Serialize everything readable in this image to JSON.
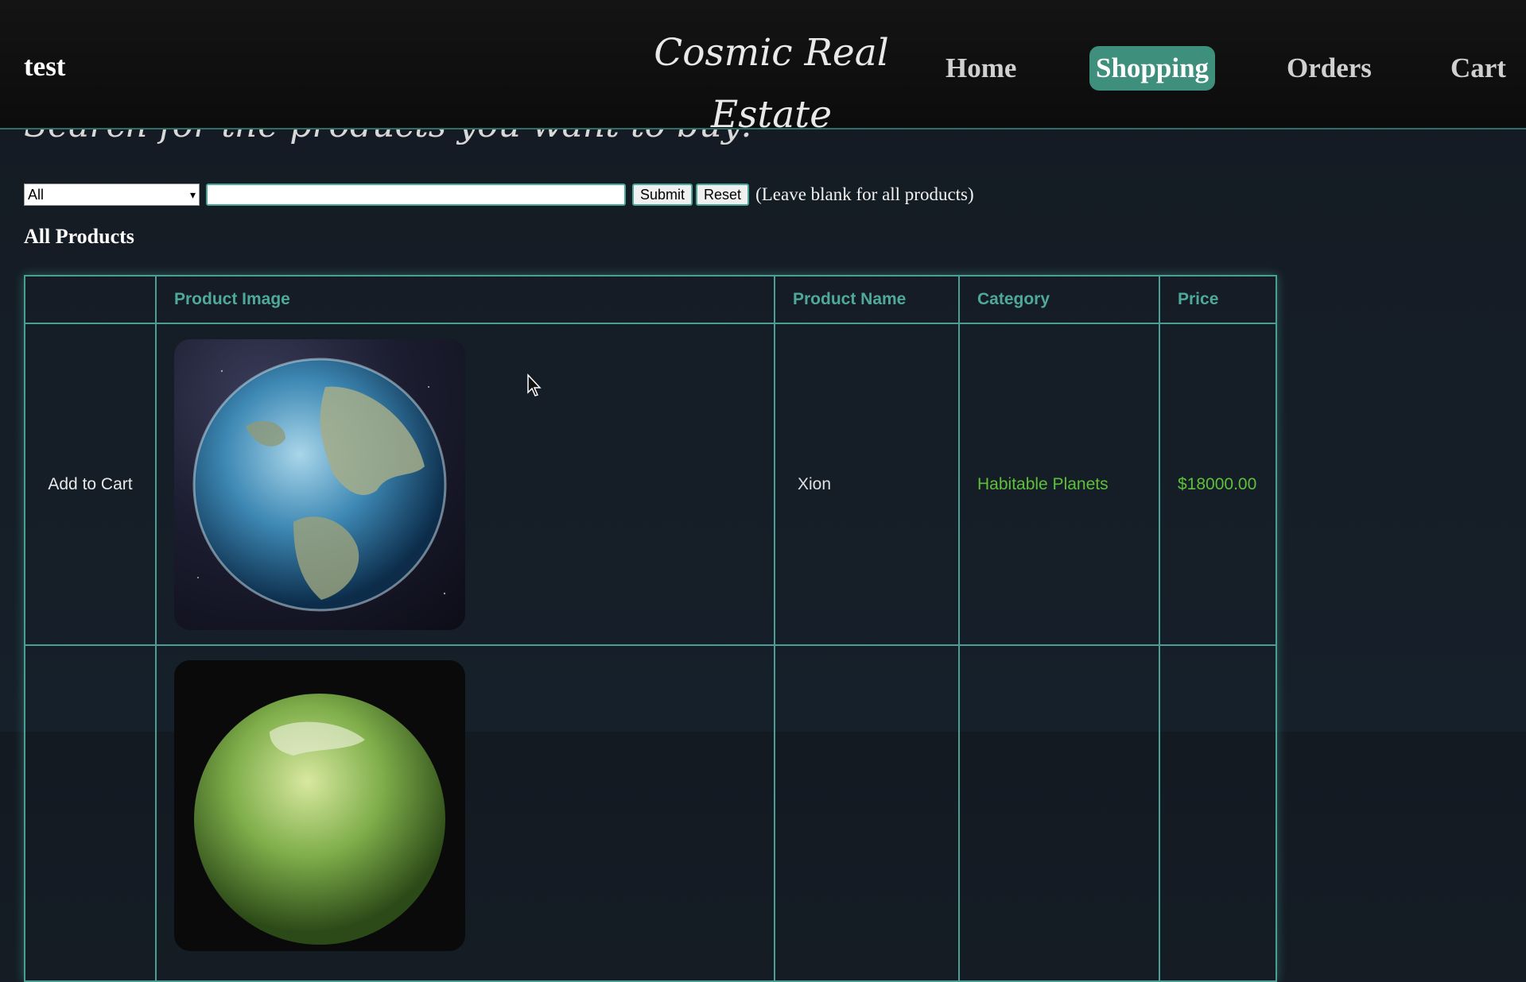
{
  "header": {
    "user_name": "test",
    "site_title": "Cosmic Real Estate",
    "nav": [
      "Home",
      "Shopping",
      "Orders",
      "Cart"
    ],
    "active_nav": "Shopping"
  },
  "search": {
    "heading": "Search for the products you want to buy:",
    "category_selected": "All",
    "input_value": "",
    "submit_label": "Submit",
    "reset_label": "Reset",
    "hint": "(Leave blank for all products)"
  },
  "products": {
    "heading": "All Products",
    "columns": [
      "",
      "Product Image",
      "Product Name",
      "Category",
      "Price"
    ],
    "rows": [
      {
        "action": "Add to Cart",
        "image_icon": "planet-blue-image",
        "name": "Xion",
        "category": "Habitable Planets",
        "price": "$18000.00"
      },
      {
        "action": "",
        "image_icon": "planet-green-image",
        "name": "",
        "category": "",
        "price": ""
      }
    ]
  },
  "colors": {
    "accent": "#3e8f7c",
    "table_border": "#4a9e93",
    "header_text": "#4fa99b",
    "green_text": "#5ec03a"
  }
}
